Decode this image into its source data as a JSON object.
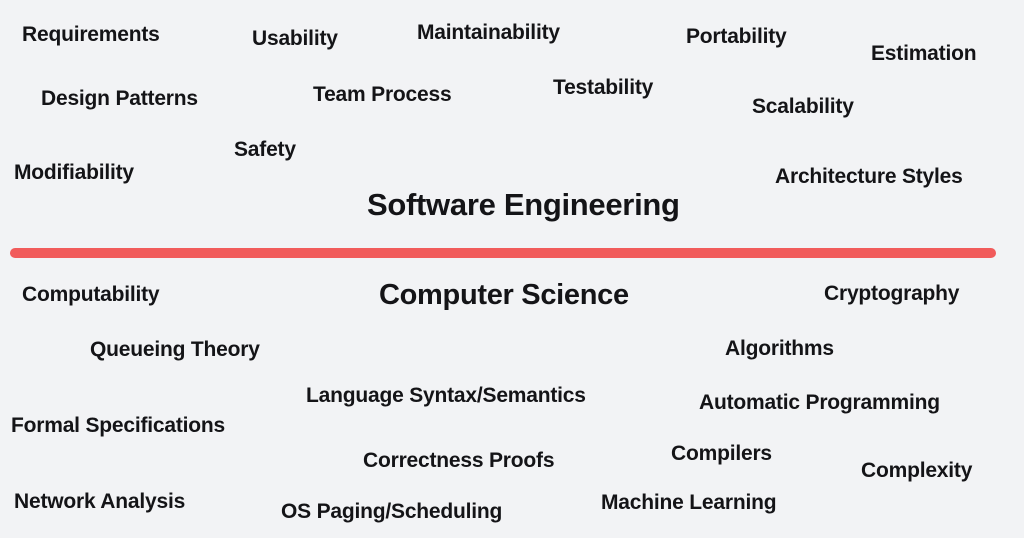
{
  "background_color": "#f2f3f5",
  "text_color": "#141417",
  "divider": {
    "name": "red-divider",
    "color": "#f15b5b",
    "label": ""
  },
  "software_engineering": {
    "heading": "Software Engineering",
    "terms": [
      "Requirements",
      "Usability",
      "Maintainability",
      "Portability",
      "Estimation",
      "Design Patterns",
      "Team Process",
      "Testability",
      "Scalability",
      "Safety",
      "Modifiability",
      "Architecture Styles"
    ]
  },
  "computer_science": {
    "heading": "Computer Science",
    "terms": [
      "Computability",
      "Cryptography",
      "Queueing Theory",
      "Algorithms",
      "Language Syntax/Semantics",
      "Automatic Programming",
      "Formal Specifications",
      "Correctness Proofs",
      "Compilers",
      "Complexity",
      "Network Analysis",
      "OS Paging/Scheduling",
      "Machine Learning"
    ]
  }
}
